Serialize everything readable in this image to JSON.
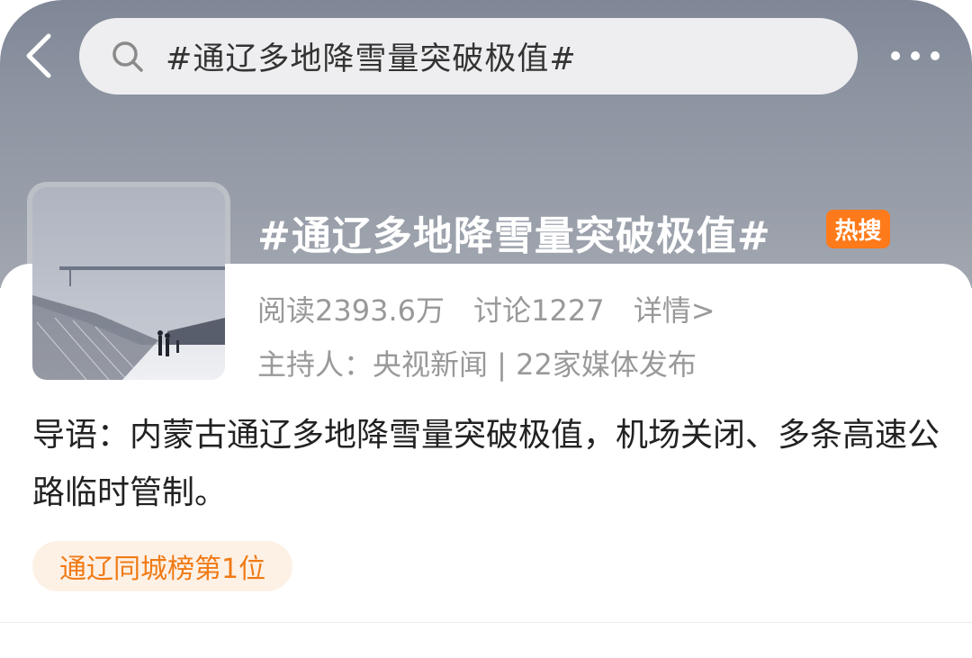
{
  "header": {
    "search_text": "#通辽多地降雪量突破极值#"
  },
  "topic": {
    "title": "#通辽多地降雪量突破极值#",
    "badge": "热搜",
    "reads": "阅读2393.6万",
    "discussions": "讨论1227",
    "details_link": "详情>",
    "host_line": "主持人：央视新闻 | 22家媒体发布",
    "intro": "导语：内蒙古通辽多地降雪量突破极值，机场关闭、多条高速公路临时管制。",
    "rank_label": "通辽同城榜第1位"
  },
  "colors": {
    "hot_badge": "#ff7a1a",
    "rank_text": "#f07a14",
    "rank_bg": "#fdf1e6"
  },
  "icons": [
    "back-arrow-icon",
    "search-icon",
    "more-dots-icon"
  ]
}
